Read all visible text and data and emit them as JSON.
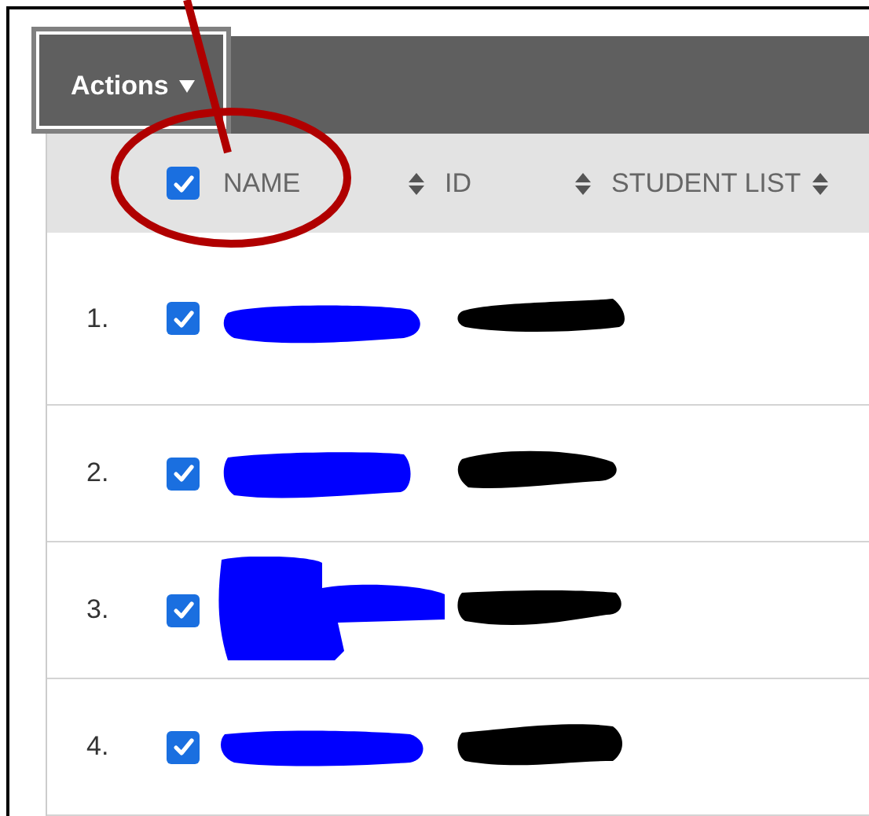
{
  "toolbar": {
    "actions_label": "Actions"
  },
  "header": {
    "select_all_checked": true,
    "columns": [
      {
        "label": "NAME",
        "sortable": true
      },
      {
        "label": "ID",
        "sortable": true
      },
      {
        "label": "STUDENT LIST",
        "sortable": true
      }
    ]
  },
  "rows": [
    {
      "number": "1.",
      "checked": true
    },
    {
      "number": "2.",
      "checked": true
    },
    {
      "number": "3.",
      "checked": true
    },
    {
      "number": "4.",
      "checked": true
    }
  ]
}
